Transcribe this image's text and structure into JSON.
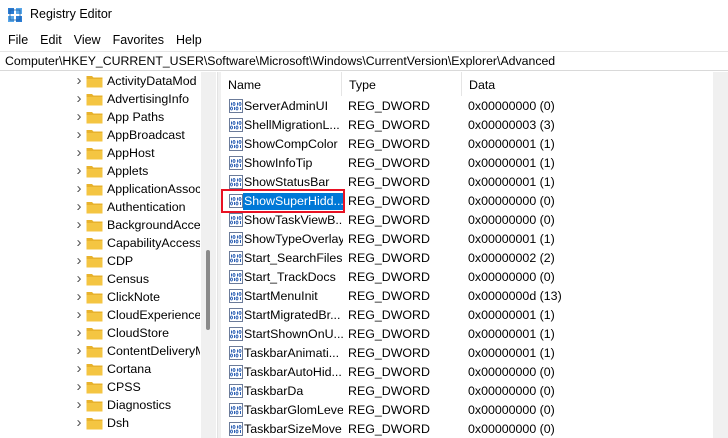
{
  "window": {
    "title": "Registry Editor",
    "icon": "registry-editor-icon"
  },
  "menu": {
    "items": [
      "File",
      "Edit",
      "View",
      "Favorites",
      "Help"
    ]
  },
  "address": {
    "path": "Computer\\HKEY_CURRENT_USER\\Software\\Microsoft\\Windows\\CurrentVersion\\Explorer\\Advanced"
  },
  "tree": {
    "items": [
      "ActivityDataMod",
      "AdvertisingInfo",
      "App Paths",
      "AppBroadcast",
      "AppHost",
      "Applets",
      "ApplicationAssoc",
      "Authentication",
      "BackgroundAcce",
      "CapabilityAccess",
      "CDP",
      "Census",
      "ClickNote",
      "CloudExperience",
      "CloudStore",
      "ContentDeliveryM",
      "Cortana",
      "CPSS",
      "Diagnostics",
      "Dsh"
    ]
  },
  "columns": {
    "name": "Name",
    "type": "Type",
    "data": "Data"
  },
  "values": [
    {
      "name": "ServerAdminUI",
      "type": "REG_DWORD",
      "data": "0x00000000 (0)"
    },
    {
      "name": "ShellMigrationL...",
      "type": "REG_DWORD",
      "data": "0x00000003 (3)"
    },
    {
      "name": "ShowCompColor",
      "type": "REG_DWORD",
      "data": "0x00000001 (1)"
    },
    {
      "name": "ShowInfoTip",
      "type": "REG_DWORD",
      "data": "0x00000001 (1)"
    },
    {
      "name": "ShowStatusBar",
      "type": "REG_DWORD",
      "data": "0x00000001 (1)"
    },
    {
      "name": "ShowSuperHidd...",
      "type": "REG_DWORD",
      "data": "0x00000000 (0)",
      "selected": true
    },
    {
      "name": "ShowTaskViewB...",
      "type": "REG_DWORD",
      "data": "0x00000000 (0)"
    },
    {
      "name": "ShowTypeOverlay",
      "type": "REG_DWORD",
      "data": "0x00000001 (1)"
    },
    {
      "name": "Start_SearchFiles",
      "type": "REG_DWORD",
      "data": "0x00000002 (2)"
    },
    {
      "name": "Start_TrackDocs",
      "type": "REG_DWORD",
      "data": "0x00000000 (0)"
    },
    {
      "name": "StartMenuInit",
      "type": "REG_DWORD",
      "data": "0x0000000d (13)"
    },
    {
      "name": "StartMigratedBr...",
      "type": "REG_DWORD",
      "data": "0x00000001 (1)"
    },
    {
      "name": "StartShownOnU...",
      "type": "REG_DWORD",
      "data": "0x00000001 (1)"
    },
    {
      "name": "TaskbarAnimati...",
      "type": "REG_DWORD",
      "data": "0x00000001 (1)"
    },
    {
      "name": "TaskbarAutoHid...",
      "type": "REG_DWORD",
      "data": "0x00000000 (0)"
    },
    {
      "name": "TaskbarDa",
      "type": "REG_DWORD",
      "data": "0x00000000 (0)"
    },
    {
      "name": "TaskbarGlomLevel",
      "type": "REG_DWORD",
      "data": "0x00000000 (0)"
    },
    {
      "name": "TaskbarSizeMove",
      "type": "REG_DWORD",
      "data": "0x00000000 (0)"
    }
  ],
  "colors": {
    "selection": "#0078d7",
    "highlight_border": "#e81123",
    "folder": "#f4c542"
  }
}
